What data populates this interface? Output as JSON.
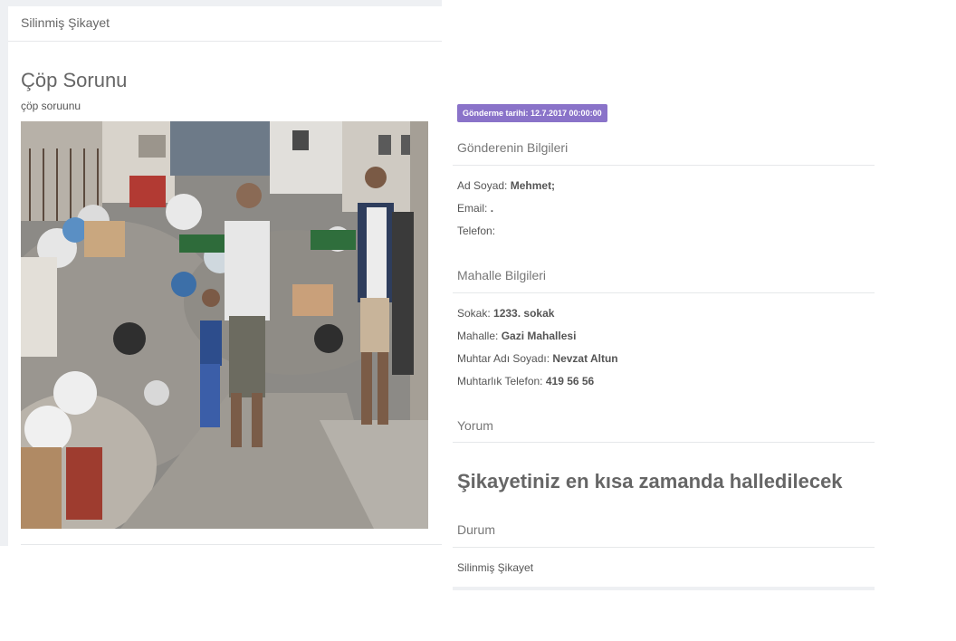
{
  "header": {
    "title": "Silinmiş Şikayet"
  },
  "complaint": {
    "title": "Çöp Sorunu",
    "description": "çöp soruunu",
    "image_alt": "Sokakta biriken çöpler"
  },
  "date_badge": "Gönderme tarihi: 12.7.2017 00:00:00",
  "sender": {
    "section_title": "Gönderenin Bilgileri",
    "name_label": "Ad Soyad:",
    "name_value": "Mehmet;",
    "email_label": "Email:",
    "email_value": ".",
    "phone_label": "Telefon:",
    "phone_value": ""
  },
  "neighborhood": {
    "section_title": "Mahalle Bilgileri",
    "street_label": "Sokak:",
    "street_value": "1233. sokak",
    "district_label": "Mahalle:",
    "district_value": "Gazi Mahallesi",
    "headman_label": "Muhtar Adı Soyadı:",
    "headman_value": "Nevzat Altun",
    "office_phone_label": "Muhtarlık Telefon:",
    "office_phone_value": "419 56 56"
  },
  "comment": {
    "section_title": "Yorum",
    "text": "Şikayetiniz en kısa zamanda halledilecek"
  },
  "status": {
    "section_title": "Durum",
    "value": "Silinmiş Şikayet"
  },
  "colors": {
    "badge": "#8a73c9",
    "page_bg": "#eef0f3",
    "divider": "#e6e8ea"
  }
}
